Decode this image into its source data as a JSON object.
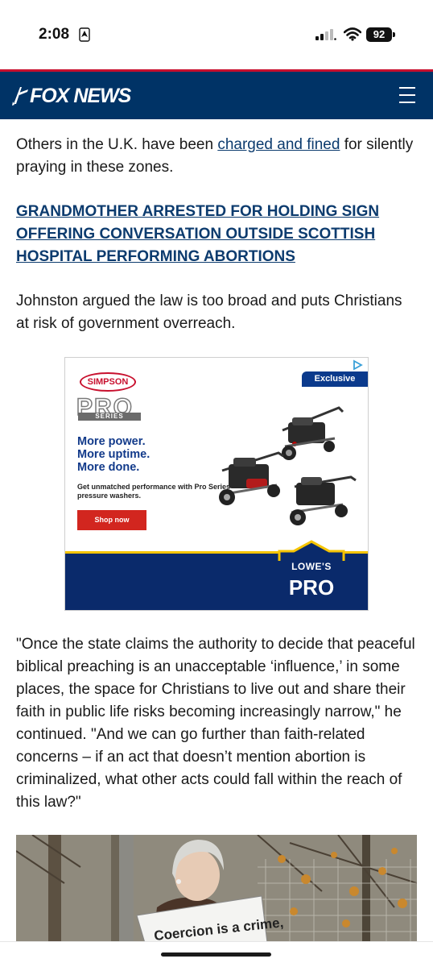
{
  "status_bar": {
    "time": "2:08",
    "battery": "92",
    "icons": [
      "location-icon",
      "signal-icon",
      "wifi-icon",
      "battery-icon"
    ]
  },
  "header": {
    "logo_text": "FOX NEWS",
    "menu_icon": "hamburger-menu-icon",
    "background": "#003366",
    "accent": "#c8102e"
  },
  "article": {
    "p1_before": "Others in the U.K. have been ",
    "p1_link": "charged and fined",
    "p1_after": " for silently praying in these zones.",
    "related_link": "GRANDMOTHER ARRESTED FOR HOLDING SIGN OFFERING CONVERSATION OUTSIDE SCOTTISH HOSPITAL PERFORMING ABORTIONS",
    "p2": "Johnston argued the law is too broad and puts Christians at risk of government overreach.",
    "p3": "\"Once the state claims the authority to decide that peaceful biblical preaching is an unacceptable ‘influence,’ in some places, the space for Christians to live out and share their faith in public life risks becoming increasingly narrow,\" he continued. \"And we can go further than faith-related concerns – if an act that doesn’t mention abortion is criminalized, what other acts could fall within the reach of this law?\"",
    "link_color": "#0c3b6e"
  },
  "ad": {
    "badge": "Exclusive",
    "brand": "SIMPSON",
    "product_line": "PRO",
    "product_series": "SERIES",
    "headline_1": "More power.",
    "headline_2": "More uptime.",
    "headline_3": "More done.",
    "subtext": "Get unmatched performance with Pro Series pressure washers.",
    "cta": "Shop now",
    "retailer": "LOWE'S",
    "retailer_program": "PRO"
  },
  "photo": {
    "sign_text": "Coercion is a crime,"
  }
}
